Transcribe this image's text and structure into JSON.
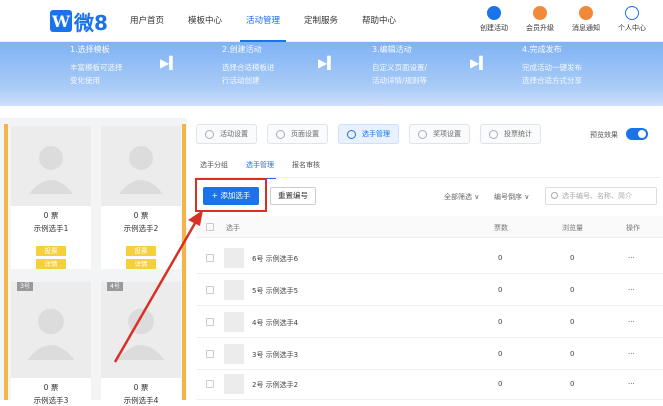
{
  "logo": {
    "mark": "W",
    "text": "微8"
  },
  "nav": [
    "用户首页",
    "模板中心",
    "活动管理",
    "定制服务",
    "帮助中心"
  ],
  "right_nav": [
    {
      "label": "创建活动",
      "icon": "star-icon",
      "color": "#1a73e8"
    },
    {
      "label": "会员升级",
      "icon": "crown-icon",
      "color": "#f08a3a"
    },
    {
      "label": "消息通知",
      "icon": "bell-icon",
      "color": "#f08a3a"
    },
    {
      "label": "个人中心",
      "icon": "user-icon",
      "color": "#1a73e8"
    }
  ],
  "steps": [
    {
      "title": "1.选择模板",
      "desc": "丰富模板可选择\n变化使用"
    },
    {
      "title": "2.创建活动",
      "desc": "选择合适模板进\n行活动创建"
    },
    {
      "title": "3.编辑活动",
      "desc": "自定义页面设置/\n活动详情/规则等"
    },
    {
      "title": "4.完成发布",
      "desc": "完成活动一键发布\n选择合适方式分享"
    }
  ],
  "preview_cards": [
    {
      "votes": "0 票",
      "name": "示例选手1",
      "btn1": "投票",
      "btn2": "详情"
    },
    {
      "votes": "0 票",
      "name": "示例选手2",
      "btn1": "投票",
      "btn2": "详情"
    },
    {
      "tag": "3号",
      "votes": "0 票",
      "name": "示例选手3"
    },
    {
      "tag": "4号",
      "votes": "0 票",
      "name": "示例选手4"
    }
  ],
  "tabs": [
    "活动设置",
    "页面设置",
    "选手管理",
    "奖项设置",
    "投票统计"
  ],
  "preview_label": "预览效果",
  "subtabs": [
    "选手分组",
    "选手管理",
    "报名审核"
  ],
  "toolbar": {
    "add": "+ 添加选手",
    "reset": "重置编号",
    "filter_all": "全部筛选 ∨",
    "filter_order": "编号倒序 ∨",
    "search_placeholder": "选手编号、名称、简介"
  },
  "table": {
    "headers": {
      "player": "选手",
      "votes": "票数",
      "views": "浏览量",
      "ops": "操作"
    },
    "rows": [
      {
        "name": "6号  示例选手6",
        "votes": "0",
        "views": "0",
        "ops": "···"
      },
      {
        "name": "5号  示例选手5",
        "votes": "0",
        "views": "0",
        "ops": "···"
      },
      {
        "name": "4号  示例选手4",
        "votes": "0",
        "views": "0",
        "ops": "···"
      },
      {
        "name": "3号  示例选手3",
        "votes": "0",
        "views": "0",
        "ops": "···"
      },
      {
        "name": "2号  示例选手2",
        "votes": "0",
        "views": "0",
        "ops": "···"
      }
    ]
  }
}
